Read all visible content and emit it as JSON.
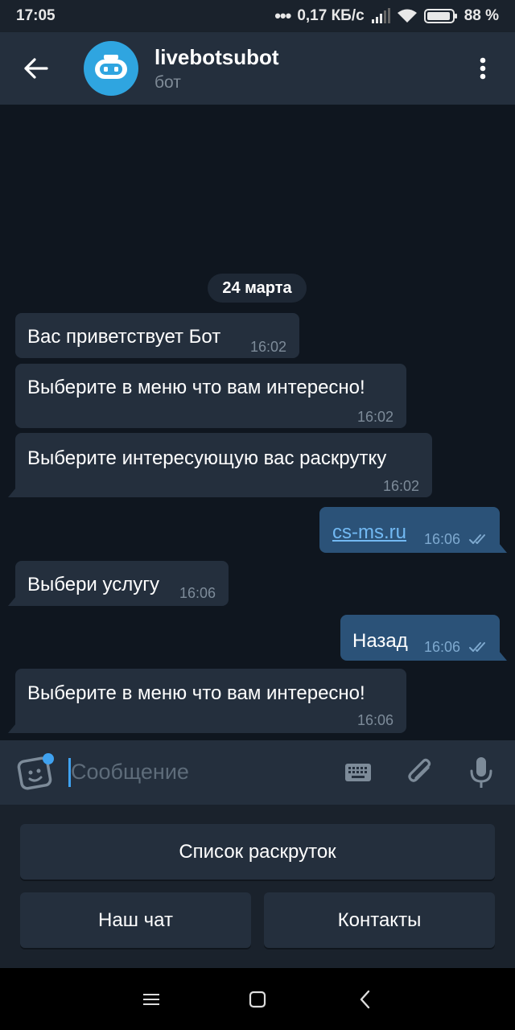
{
  "status_bar": {
    "time": "17:05",
    "dots": "•••",
    "network_speed": "0,17 КБ/с",
    "battery_percent": "88 %"
  },
  "header": {
    "title": "livebotsubot",
    "subtitle": "бот",
    "avatar_color": "#2fa5e0"
  },
  "chat": {
    "date_label": "24 марта",
    "messages": [
      {
        "direction": "in",
        "text": "Вас приветствует Бот",
        "time": "16:02"
      },
      {
        "direction": "in",
        "text": "Выберите в меню что вам интересно!",
        "time": "16:02"
      },
      {
        "direction": "in",
        "text": "Выберите интересующую вас раскрутку",
        "time": "16:02"
      },
      {
        "direction": "out",
        "text": "cs-ms.ru",
        "time": "16:06",
        "is_link": true,
        "read": true
      },
      {
        "direction": "in",
        "text": "Выбери услугу",
        "time": "16:06"
      },
      {
        "direction": "out",
        "text": "Назад",
        "time": "16:06",
        "read": true
      },
      {
        "direction": "in",
        "text": "Выберите в меню что вам интересно!",
        "time": "16:06"
      }
    ]
  },
  "composer": {
    "placeholder": "Сообщение"
  },
  "bot_keyboard": {
    "rows": [
      [
        "Список раскруток"
      ],
      [
        "Наш чат",
        "Контакты"
      ]
    ]
  },
  "colors": {
    "incoming_bubble": "#242f3d",
    "outgoing_bubble": "#2b5278",
    "chat_background": "#0f161f",
    "link": "#72b9f3",
    "accent": "#3fa2f0"
  }
}
